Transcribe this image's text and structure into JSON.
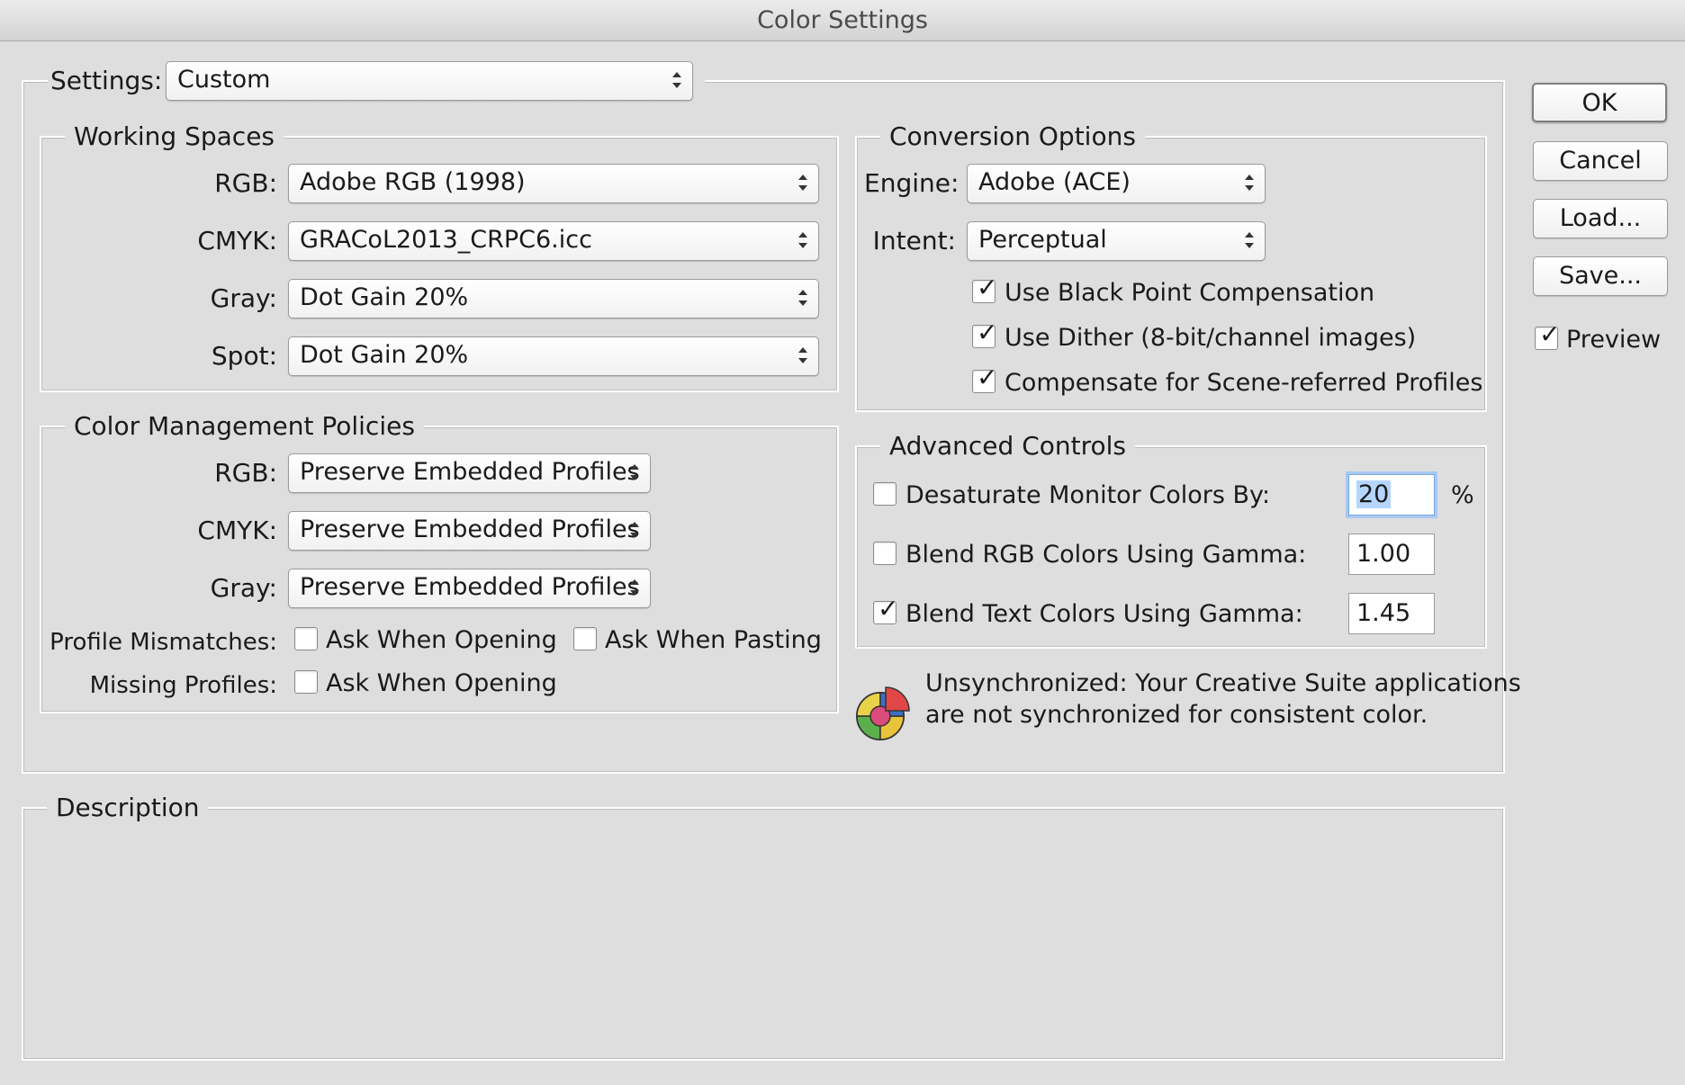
{
  "window": {
    "title": "Color Settings"
  },
  "settings": {
    "label": "Settings:",
    "value": "Custom"
  },
  "working_spaces": {
    "legend": "Working Spaces",
    "rgb": {
      "label": "RGB:",
      "value": "Adobe RGB (1998)"
    },
    "cmyk": {
      "label": "CMYK:",
      "value": "GRACoL2013_CRPC6.icc"
    },
    "gray": {
      "label": "Gray:",
      "value": "Dot Gain 20%"
    },
    "spot": {
      "label": "Spot:",
      "value": "Dot Gain 20%"
    }
  },
  "policies": {
    "legend": "Color Management Policies",
    "rgb": {
      "label": "RGB:",
      "value": "Preserve Embedded Profiles"
    },
    "cmyk": {
      "label": "CMYK:",
      "value": "Preserve Embedded Profiles"
    },
    "gray": {
      "label": "Gray:",
      "value": "Preserve Embedded Profiles"
    },
    "profile_mismatches": {
      "label": "Profile Mismatches:",
      "ask_opening": {
        "label": "Ask When Opening",
        "checked": false
      },
      "ask_pasting": {
        "label": "Ask When Pasting",
        "checked": false
      }
    },
    "missing_profiles": {
      "label": "Missing Profiles:",
      "ask_opening": {
        "label": "Ask When Opening",
        "checked": false
      }
    }
  },
  "conversion": {
    "legend": "Conversion Options",
    "engine": {
      "label": "Engine:",
      "value": "Adobe (ACE)"
    },
    "intent": {
      "label": "Intent:",
      "value": "Perceptual"
    },
    "black_point": {
      "label": "Use Black Point Compensation",
      "checked": true
    },
    "dither": {
      "label": "Use Dither (8-bit/channel images)",
      "checked": true
    },
    "scene_referred": {
      "label": "Compensate for Scene-referred Profiles",
      "checked": true
    }
  },
  "advanced": {
    "legend": "Advanced Controls",
    "desaturate": {
      "label": "Desaturate Monitor Colors By:",
      "checked": false,
      "value": "20",
      "unit": "%"
    },
    "blend_rgb": {
      "label": "Blend RGB Colors Using Gamma:",
      "checked": false,
      "value": "1.00"
    },
    "blend_text": {
      "label": "Blend Text Colors Using Gamma:",
      "checked": true,
      "value": "1.45"
    }
  },
  "sync_status": {
    "icon": "color-sync-icon",
    "line1": "Unsynchronized: Your Creative Suite applications",
    "line2": "are not synchronized for consistent color."
  },
  "description": {
    "legend": "Description",
    "text": ""
  },
  "buttons": {
    "ok": "OK",
    "cancel": "Cancel",
    "load": "Load...",
    "save": "Save..."
  },
  "preview": {
    "label": "Preview",
    "checked": true
  },
  "colors": {
    "window_bg": "#dedede",
    "focus_ring": "#a9c8f2",
    "selection": "#b5d5ff"
  }
}
